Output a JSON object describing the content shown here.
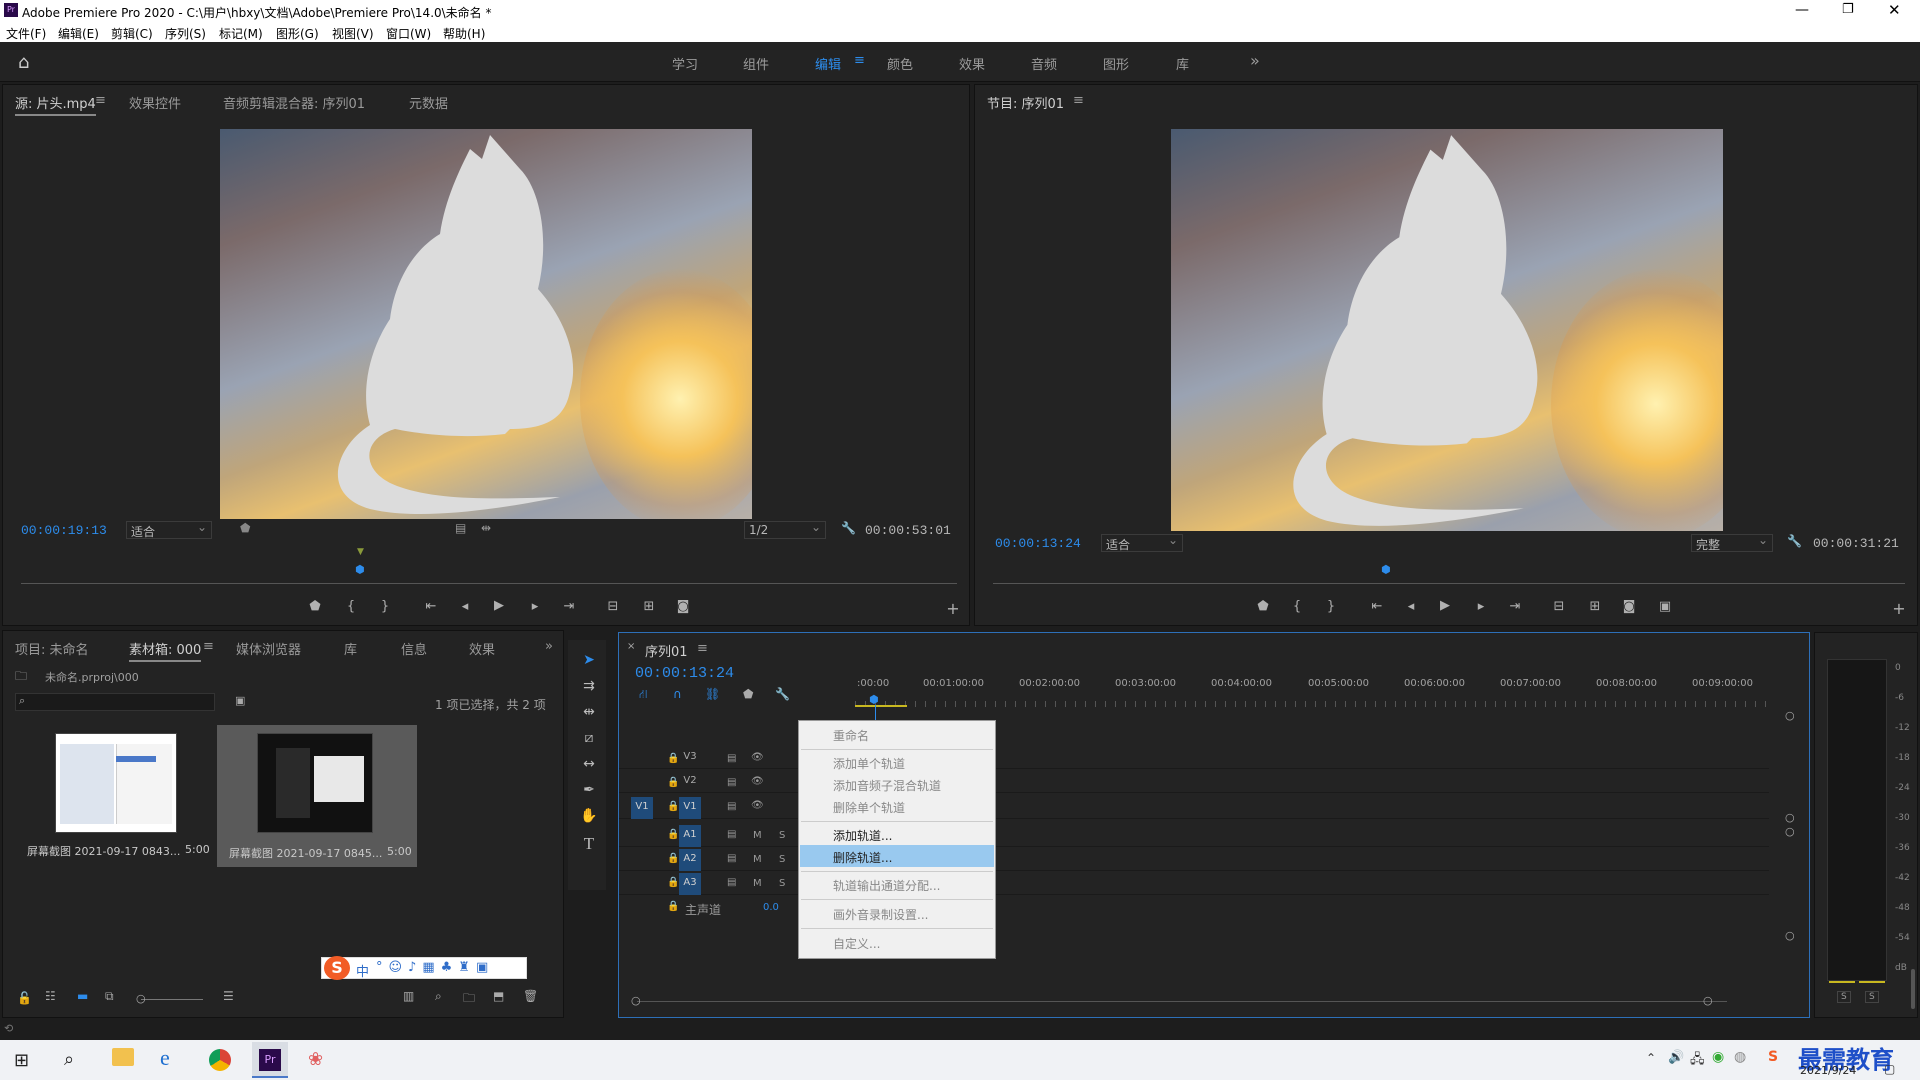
{
  "window": {
    "title": "Adobe Premiere Pro 2020 - C:\\用户\\hbxy\\文档\\Adobe\\Premiere Pro\\14.0\\未命名 *",
    "app_icon": "Pr"
  },
  "menu": [
    "文件(F)",
    "编辑(E)",
    "剪辑(C)",
    "序列(S)",
    "标记(M)",
    "图形(G)",
    "视图(V)",
    "窗口(W)",
    "帮助(H)"
  ],
  "workspaces": {
    "items": [
      "学习",
      "组件",
      "编辑",
      "颜色",
      "效果",
      "音频",
      "图形",
      "库"
    ],
    "active": "编辑",
    "more": "»"
  },
  "source_panel": {
    "tabs": [
      "源: 片头.mp4",
      "效果控件",
      "音频剪辑混合器: 序列01",
      "元数据"
    ],
    "timecode": "00:00:19:13",
    "fit": "适合",
    "resolution": "1/2",
    "duration": "00:00:53:01"
  },
  "program_panel": {
    "tab": "节目: 序列01",
    "timecode": "00:00:13:24",
    "fit": "适合",
    "quality": "完整",
    "duration": "00:00:31:21"
  },
  "project_panel": {
    "tabs": [
      "项目: 未命名",
      "素材箱: 000",
      "媒体浏览器",
      "库",
      "信息",
      "效果"
    ],
    "path": "未命名.prproj\\000",
    "selection_info": "1 项已选择，共 2 项",
    "search_placeholder": "",
    "items": [
      {
        "name": "屏幕截图 2021-09-17 0843...",
        "duration": "5:00"
      },
      {
        "name": "屏幕截图 2021-09-17 0845...",
        "duration": "5:00"
      }
    ]
  },
  "timeline": {
    "tab": "序列01",
    "timecode": "00:00:13:24",
    "ruler": [
      ":00:00",
      "00:01:00:00",
      "00:02:00:00",
      "00:03:00:00",
      "00:04:00:00",
      "00:05:00:00",
      "00:06:00:00",
      "00:07:00:00",
      "00:08:00:00",
      "00:09:00:00"
    ],
    "video_tracks": [
      "V3",
      "V2",
      "V1"
    ],
    "audio_tracks": [
      "A1",
      "A2",
      "A3"
    ],
    "source_patch": "V1",
    "master_label": "主声道",
    "master_value": "0.0",
    "mute": "M",
    "solo": "S"
  },
  "context_menu": {
    "items": [
      "重命名",
      "添加单个轨道",
      "添加音频子混合轨道",
      "删除单个轨道",
      "添加轨道...",
      "删除轨道...",
      "轨道输出通道分配...",
      "画外音录制设置...",
      "自定义..."
    ],
    "highlighted": "删除轨道..."
  },
  "audio_meter": {
    "scale": [
      "0",
      "-6",
      "-12",
      "-18",
      "-24",
      "-30",
      "-36",
      "-42",
      "-48",
      "-54",
      "dB"
    ],
    "solo_left": "S",
    "solo_right": "S"
  },
  "ime_toolbar": {
    "lang": "中"
  },
  "taskbar": {
    "date": "2021/9/24",
    "watermark": "最需教育"
  },
  "colors": {
    "accent_blue": "#2d8ceb",
    "panel_bg": "#232323",
    "highlight": "#99c9ef"
  }
}
